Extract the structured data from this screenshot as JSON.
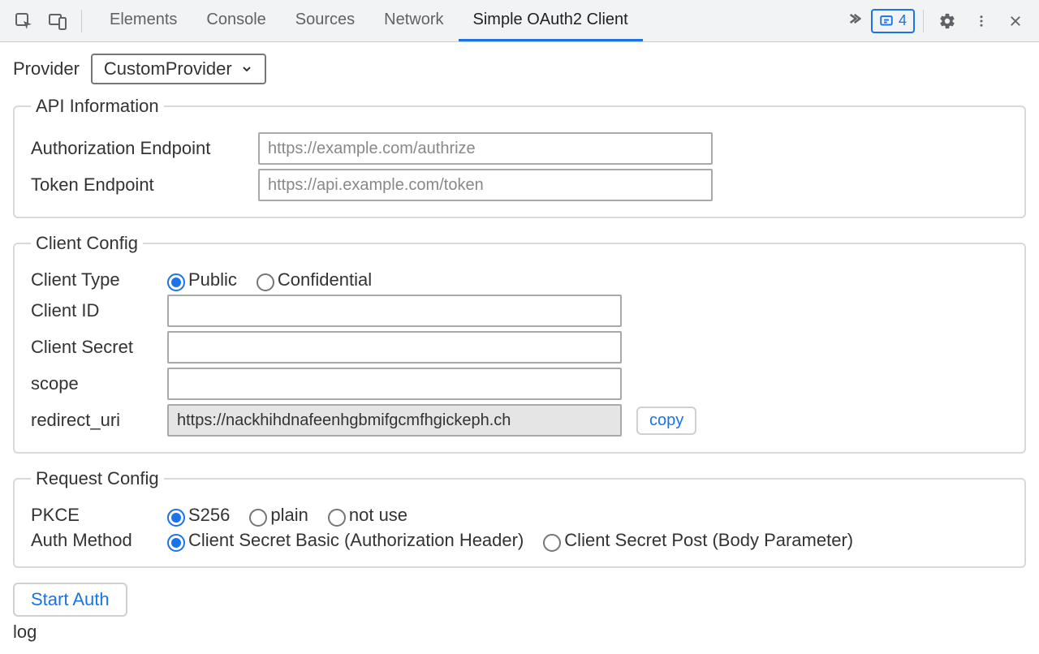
{
  "toolbar": {
    "tabs": [
      "Elements",
      "Console",
      "Sources",
      "Network",
      "Simple OAuth2 Client"
    ],
    "active_tab_index": 4,
    "badge_count": "4"
  },
  "provider": {
    "label": "Provider",
    "selected": "CustomProvider"
  },
  "api_info": {
    "legend": "API Information",
    "auth_endpoint_label": "Authorization Endpoint",
    "auth_endpoint_placeholder": "https://example.com/authrize",
    "auth_endpoint_value": "",
    "token_endpoint_label": "Token Endpoint",
    "token_endpoint_placeholder": "https://api.example.com/token",
    "token_endpoint_value": ""
  },
  "client_config": {
    "legend": "Client Config",
    "client_type_label": "Client Type",
    "client_type_options": [
      "Public",
      "Confidential"
    ],
    "client_type_selected": "Public",
    "client_id_label": "Client ID",
    "client_id_value": "",
    "client_secret_label": "Client Secret",
    "client_secret_value": "",
    "scope_label": "scope",
    "scope_value": "",
    "redirect_uri_label": "redirect_uri",
    "redirect_uri_value": "https://nackhihdnafeenhgbmifgcmfhgickeph.ch",
    "copy_label": "copy"
  },
  "request_config": {
    "legend": "Request Config",
    "pkce_label": "PKCE",
    "pkce_options": [
      "S256",
      "plain",
      "not use"
    ],
    "pkce_selected": "S256",
    "auth_method_label": "Auth Method",
    "auth_method_options": [
      "Client Secret Basic (Authorization Header)",
      "Client Secret Post (Body Parameter)"
    ],
    "auth_method_selected": "Client Secret Basic (Authorization Header)"
  },
  "actions": {
    "start_auth_label": "Start Auth"
  },
  "log_label": "log"
}
